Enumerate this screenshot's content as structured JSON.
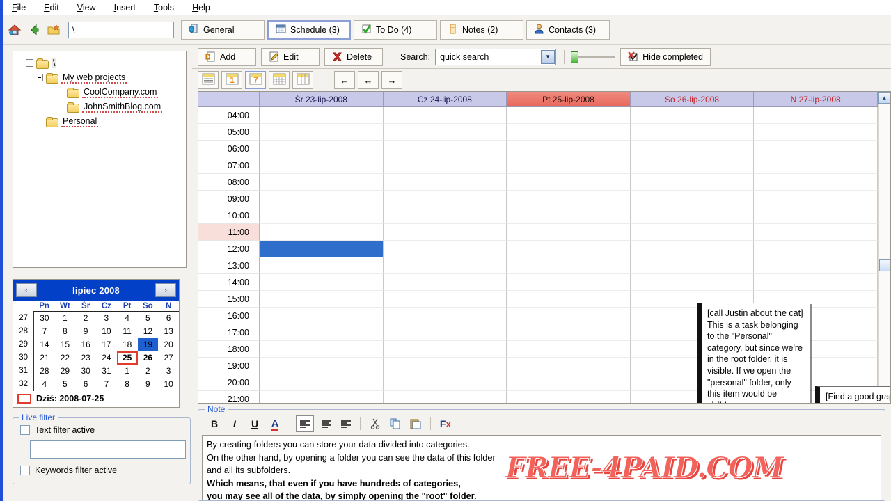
{
  "menu": {
    "items": [
      {
        "label": "File",
        "mnemonic": "F"
      },
      {
        "label": "Edit",
        "mnemonic": "E"
      },
      {
        "label": "View",
        "mnemonic": "V"
      },
      {
        "label": "Insert",
        "mnemonic": "I"
      },
      {
        "label": "Tools",
        "mnemonic": "T"
      },
      {
        "label": "Help",
        "mnemonic": "H"
      }
    ]
  },
  "toolbar": {
    "icons": [
      "home-icon",
      "back-arrow-icon",
      "new-folder-icon"
    ],
    "path_value": "\\"
  },
  "tabs": [
    {
      "label": "General",
      "icon": "general-icon",
      "selected": false
    },
    {
      "label": "Schedule (3)",
      "icon": "calendar-icon",
      "selected": true
    },
    {
      "label": "To Do (4)",
      "icon": "checkmark-icon",
      "selected": false
    },
    {
      "label": "Notes (2)",
      "icon": "note-icon",
      "selected": false
    },
    {
      "label": "Contacts (3)",
      "icon": "contact-icon",
      "selected": false
    }
  ],
  "tree": {
    "nodes": [
      {
        "label": "\\",
        "level": 0,
        "expander": "minus",
        "selected": true,
        "spell": false
      },
      {
        "label": "My web projects",
        "level": 1,
        "expander": "minus",
        "selected": false,
        "spell": true
      },
      {
        "label": "CoolCompany.com",
        "level": 2,
        "expander": "none",
        "selected": false,
        "spell": true
      },
      {
        "label": "JohnSmithBlog.com",
        "level": 2,
        "expander": "none",
        "selected": false,
        "spell": true
      },
      {
        "label": "Personal",
        "level": 1,
        "expander": "none",
        "selected": false,
        "spell": true
      }
    ]
  },
  "calendar": {
    "prev_label": "‹",
    "next_label": "›",
    "month_title": "lipiec 2008",
    "weekday_headers": [
      "Pn",
      "Wt",
      "Śr",
      "Cz",
      "Pt",
      "So",
      "N"
    ],
    "week_numbers": [
      27,
      28,
      29,
      30,
      31,
      32
    ],
    "weeks": [
      [
        {
          "d": "30",
          "s": "out"
        },
        {
          "d": "1",
          "s": ""
        },
        {
          "d": "2",
          "s": ""
        },
        {
          "d": "3",
          "s": ""
        },
        {
          "d": "4",
          "s": ""
        },
        {
          "d": "5",
          "s": ""
        },
        {
          "d": "6",
          "s": ""
        }
      ],
      [
        {
          "d": "7",
          "s": ""
        },
        {
          "d": "8",
          "s": ""
        },
        {
          "d": "9",
          "s": ""
        },
        {
          "d": "10",
          "s": ""
        },
        {
          "d": "11",
          "s": ""
        },
        {
          "d": "12",
          "s": ""
        },
        {
          "d": "13",
          "s": ""
        }
      ],
      [
        {
          "d": "14",
          "s": ""
        },
        {
          "d": "15",
          "s": ""
        },
        {
          "d": "16",
          "s": ""
        },
        {
          "d": "17",
          "s": ""
        },
        {
          "d": "18",
          "s": ""
        },
        {
          "d": "19",
          "s": "cur"
        },
        {
          "d": "20",
          "s": ""
        }
      ],
      [
        {
          "d": "21",
          "s": ""
        },
        {
          "d": "22",
          "s": ""
        },
        {
          "d": "23",
          "s": ""
        },
        {
          "d": "24",
          "s": ""
        },
        {
          "d": "25",
          "s": "today"
        },
        {
          "d": "26",
          "s": "bold"
        },
        {
          "d": "27",
          "s": ""
        }
      ],
      [
        {
          "d": "28",
          "s": ""
        },
        {
          "d": "29",
          "s": ""
        },
        {
          "d": "30",
          "s": ""
        },
        {
          "d": "31",
          "s": ""
        },
        {
          "d": "1",
          "s": "out"
        },
        {
          "d": "2",
          "s": "out"
        },
        {
          "d": "3",
          "s": "out"
        }
      ],
      [
        {
          "d": "4",
          "s": "out"
        },
        {
          "d": "5",
          "s": "out"
        },
        {
          "d": "6",
          "s": "out"
        },
        {
          "d": "7",
          "s": "out"
        },
        {
          "d": "8",
          "s": "out"
        },
        {
          "d": "9",
          "s": "out"
        },
        {
          "d": "10",
          "s": "out"
        }
      ]
    ],
    "today_label": "Dziś: 2008-07-25"
  },
  "live_filter": {
    "title": "Live filter",
    "text_filter_label": "Text filter active",
    "text_filter_checked": false,
    "text_filter_value": "",
    "keywords_filter_label": "Keywords filter active",
    "keywords_filter_checked": false
  },
  "actions": {
    "add_label": "Add",
    "edit_label": "Edit",
    "delete_label": "Delete",
    "search_label": "Search:",
    "search_value": "quick search",
    "hide_completed_label": "Hide completed"
  },
  "view_modes": [
    {
      "name": "list-view",
      "glyph": "≡",
      "selected": false
    },
    {
      "name": "day-view",
      "glyph": "1",
      "selected": false
    },
    {
      "name": "week-view",
      "glyph": "7",
      "selected": true
    },
    {
      "name": "month-view",
      "glyph": "▦",
      "selected": false
    },
    {
      "name": "year-view",
      "glyph": "▥",
      "selected": false
    }
  ],
  "nav": {
    "prev_label": "←",
    "today_label": "↔",
    "next_label": "→"
  },
  "schedule": {
    "days": [
      {
        "label": "Śr 23-lip-2008",
        "today": false,
        "weekend": false
      },
      {
        "label": "Cz 24-lip-2008",
        "today": false,
        "weekend": false
      },
      {
        "label": "Pt 25-lip-2008",
        "today": true,
        "weekend": false
      },
      {
        "label": "So 26-lip-2008",
        "today": false,
        "weekend": true
      },
      {
        "label": "N 27-lip-2008",
        "today": false,
        "weekend": true
      }
    ],
    "times": [
      {
        "label": "04:00",
        "hot": false
      },
      {
        "label": "05:00",
        "hot": false
      },
      {
        "label": "06:00",
        "hot": false
      },
      {
        "label": "07:00",
        "hot": false
      },
      {
        "label": "08:00",
        "hot": false
      },
      {
        "label": "09:00",
        "hot": false
      },
      {
        "label": "10:00",
        "hot": false
      },
      {
        "label": "11:00",
        "hot": true
      },
      {
        "label": "12:00",
        "hot": false
      },
      {
        "label": "13:00",
        "hot": false
      },
      {
        "label": "14:00",
        "hot": false
      },
      {
        "label": "15:00",
        "hot": false
      },
      {
        "label": "16:00",
        "hot": false
      },
      {
        "label": "17:00",
        "hot": false
      },
      {
        "label": "18:00",
        "hot": false
      },
      {
        "label": "19:00",
        "hot": false
      },
      {
        "label": "20:00",
        "hot": false
      },
      {
        "label": "21:00",
        "hot": false
      }
    ],
    "selection": {
      "row_index": 8,
      "col_index": 0
    }
  },
  "tooltips": [
    {
      "name": "tooltip-personal-task",
      "text": "[call Justin about the cat] This is a task belonging to the \"Personal\" category, but since we're in the root folder, it is visible. If we open the \"personal\" folder, only this item would be visible."
    },
    {
      "name": "tooltip-webproject-task",
      "text": "[Find a good graphician] And this task belongs to the \"My web project\", it's also visible, since we're in the root."
    }
  ],
  "note": {
    "title": "Note",
    "tools": [
      {
        "name": "bold-icon",
        "glyph": "B",
        "active": false
      },
      {
        "name": "italic-icon",
        "glyph": "I",
        "active": false
      },
      {
        "name": "underline-icon",
        "glyph": "U",
        "active": false
      },
      {
        "name": "font-color-icon",
        "glyph": "A",
        "active": false
      },
      {
        "name": "align-left-icon",
        "glyph": "≡",
        "active": true
      },
      {
        "name": "align-center-icon",
        "glyph": "≡",
        "active": false
      },
      {
        "name": "align-right-icon",
        "glyph": "≡",
        "active": false
      },
      {
        "name": "cut-icon",
        "glyph": "✂",
        "active": false
      },
      {
        "name": "copy-icon",
        "glyph": "⧉",
        "active": false
      },
      {
        "name": "paste-icon",
        "glyph": "Ὄb",
        "active": false
      },
      {
        "name": "clear-format-icon",
        "glyph": "Fx",
        "active": false
      }
    ],
    "lines": [
      {
        "text": "By creating folders you can store your data divided into categories.",
        "bold": false
      },
      {
        "text": "On the other hand, by opening a folder you can see the data of this folder",
        "bold": false
      },
      {
        "text": "and all its subfolders.",
        "bold": false
      },
      {
        "text": "Which means, that even if you have hundreds of categories,",
        "bold": true
      },
      {
        "text": "you may see all of the data, by simply opening the \"root\" folder.",
        "bold": true
      }
    ]
  },
  "watermark": {
    "text": "FREE-4PAID.COM",
    "color": "#f4625c"
  },
  "scrollbar": {
    "up_label": "▲",
    "down_label": "▼"
  }
}
